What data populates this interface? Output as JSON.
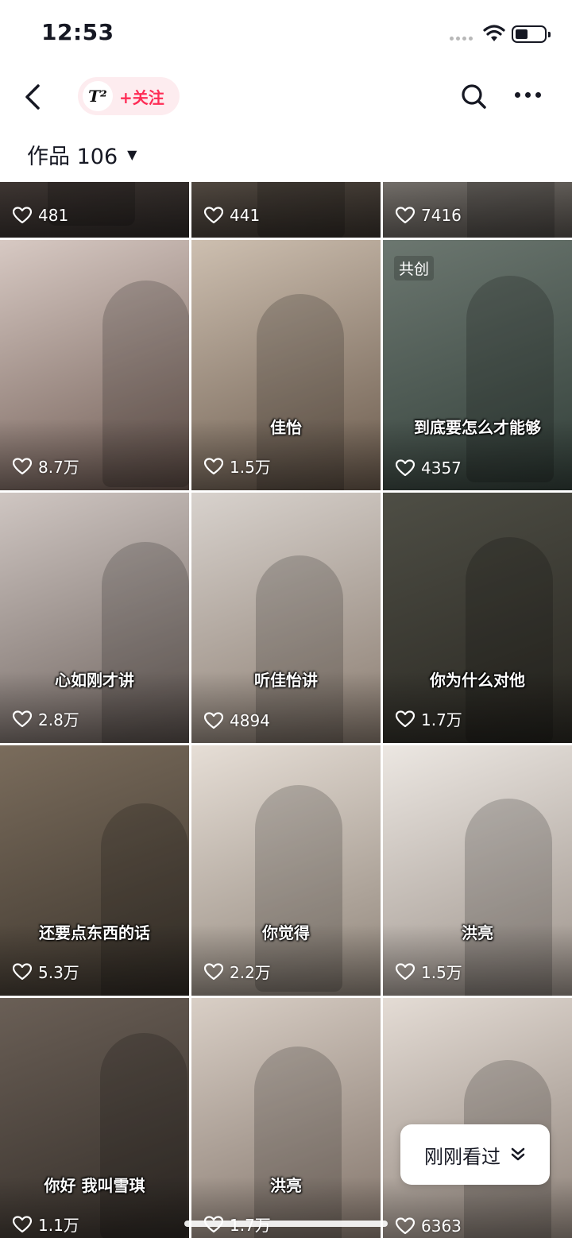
{
  "status_bar": {
    "time": "12:53",
    "battery_level": 0.45
  },
  "nav": {
    "avatar_text": "T²",
    "follow_label": "+关注",
    "icons": [
      "back-arrow-icon",
      "search-icon",
      "more-icon"
    ]
  },
  "works_header": {
    "label": "作品 106"
  },
  "colors": {
    "accent": "#fe2c55",
    "chip_bg": "#fdecef"
  },
  "videos": [
    {
      "likes": "481",
      "caption": "",
      "badge": ""
    },
    {
      "likes": "441",
      "caption": "",
      "badge": ""
    },
    {
      "likes": "7416",
      "caption": "",
      "badge": ""
    },
    {
      "likes": "8.7万",
      "caption": "",
      "badge": ""
    },
    {
      "likes": "1.5万",
      "caption": "佳怡",
      "badge": ""
    },
    {
      "likes": "4357",
      "caption": "到底要怎么才能够",
      "badge": "共创"
    },
    {
      "likes": "2.8万",
      "caption": "心如刚才讲",
      "badge": ""
    },
    {
      "likes": "4894",
      "caption": "听佳怡讲",
      "badge": ""
    },
    {
      "likes": "1.7万",
      "caption": "你为什么对他",
      "badge": ""
    },
    {
      "likes": "5.3万",
      "caption": "还要点东西的话",
      "badge": ""
    },
    {
      "likes": "2.2万",
      "caption": "你觉得",
      "badge": ""
    },
    {
      "likes": "1.5万",
      "caption": "洪亮",
      "badge": ""
    },
    {
      "likes": "1.1万",
      "caption": "你好 我叫雪琪",
      "badge": ""
    },
    {
      "likes": "1.7万",
      "caption": "洪亮",
      "badge": ""
    },
    {
      "likes": "6363",
      "caption": "",
      "badge": ""
    }
  ],
  "just_watched": {
    "label": "刚刚看过"
  }
}
